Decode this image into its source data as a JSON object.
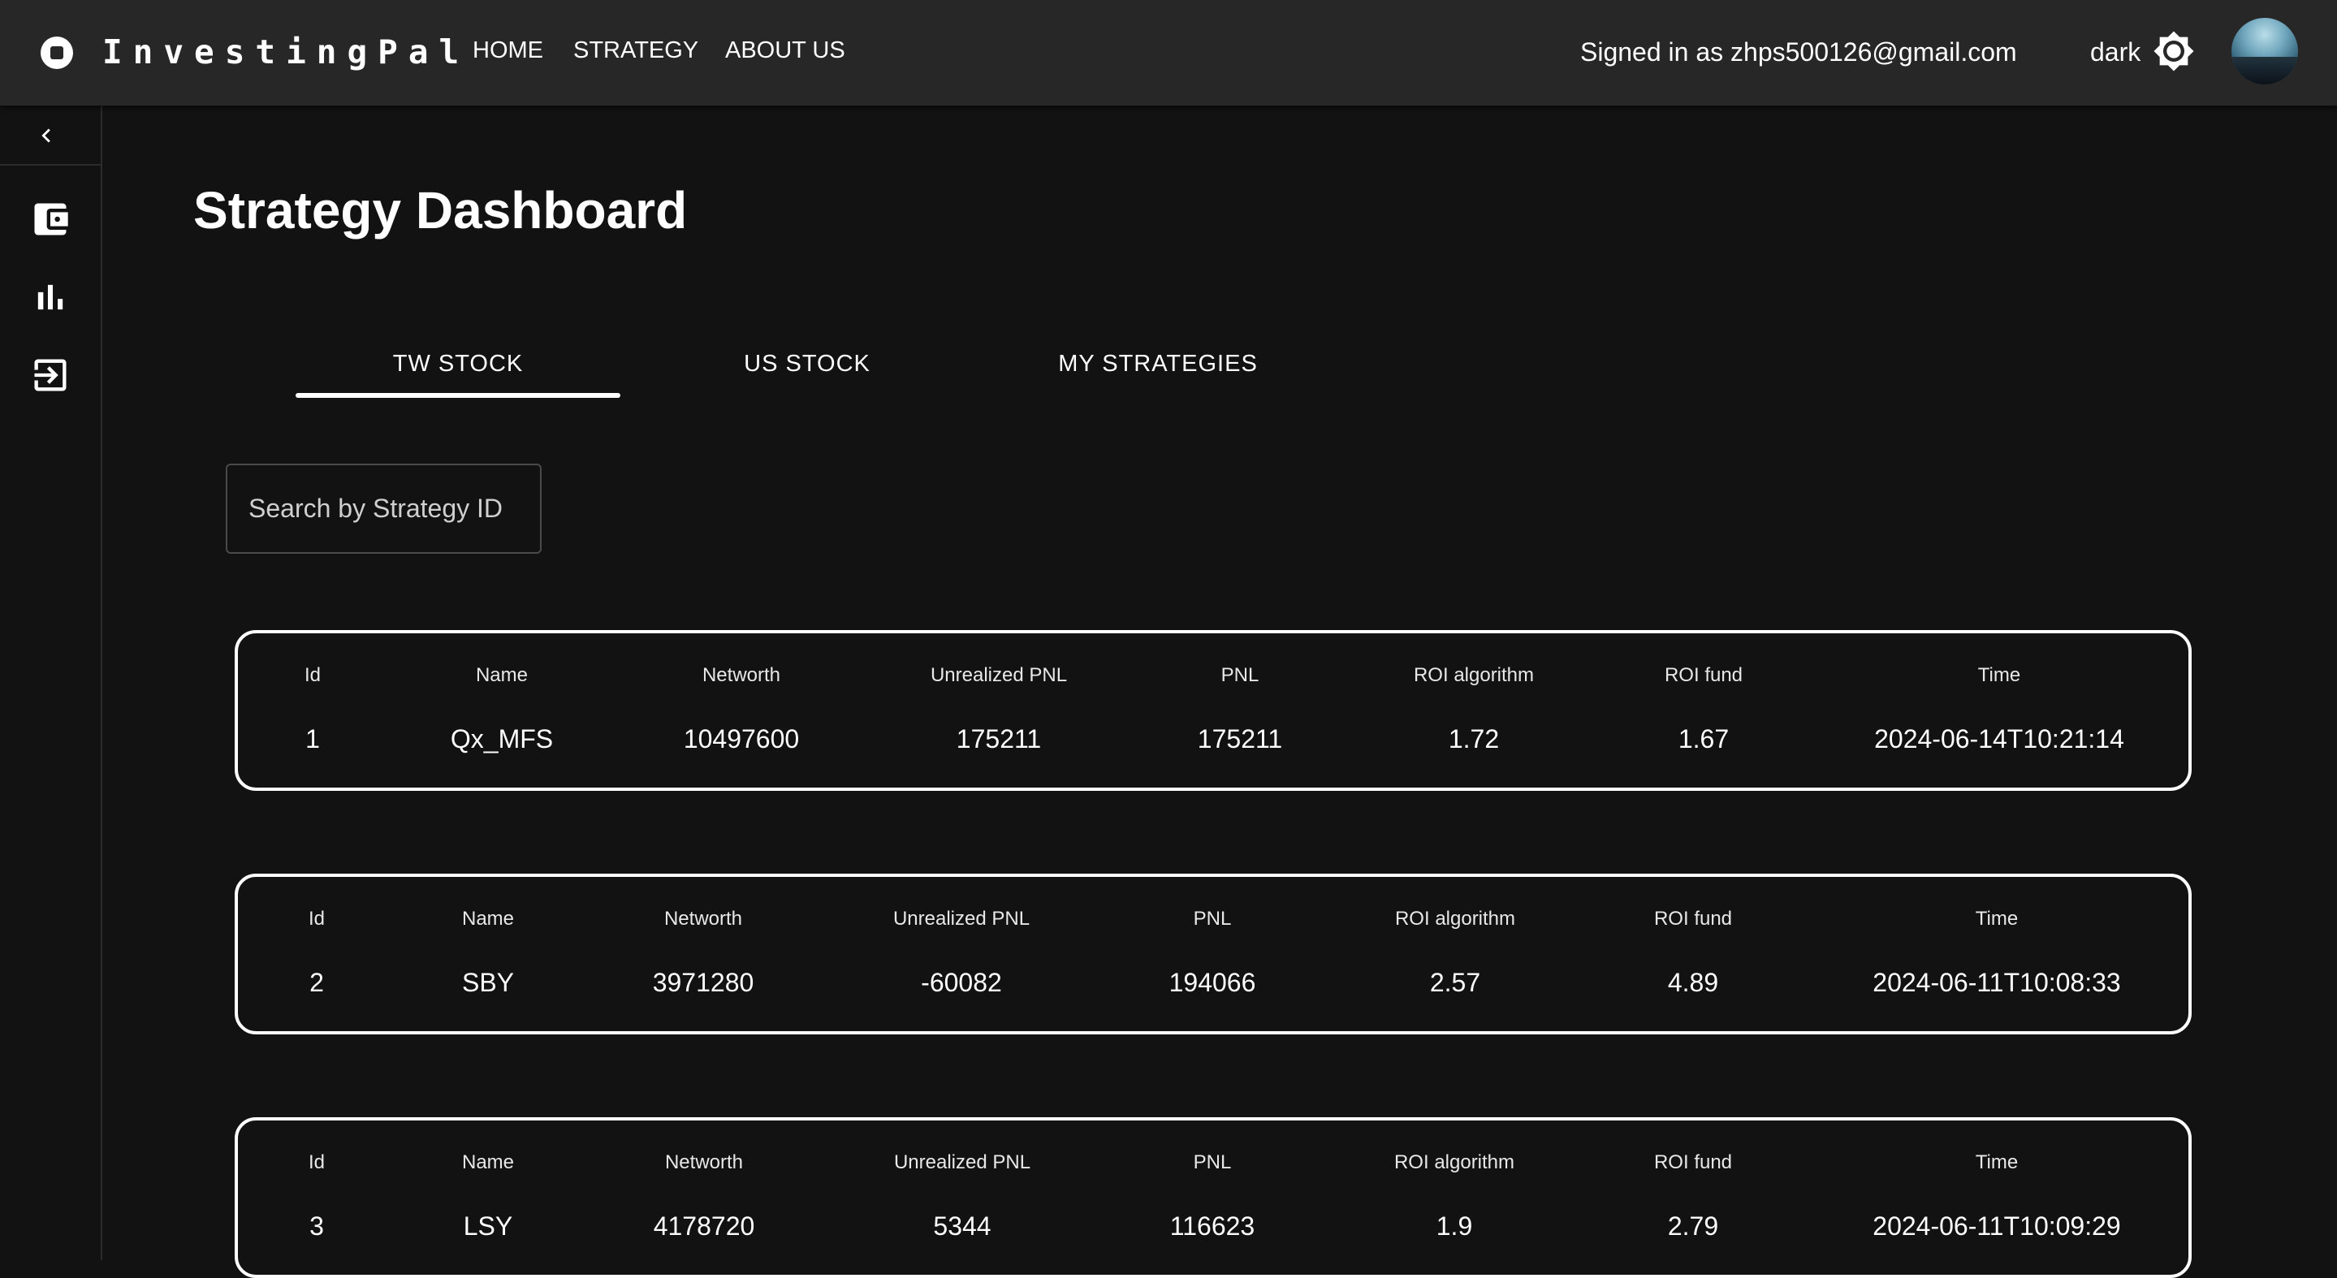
{
  "app": {
    "brand": "InvestingPal",
    "nav": [
      {
        "label": "HOME"
      },
      {
        "label": "STRATEGY"
      },
      {
        "label": "ABOUT US"
      }
    ],
    "signed_in": "Signed in as zhps500126@gmail.com",
    "theme_label": "dark",
    "icons": {
      "logo": "stop-circle-icon",
      "theme": "brightness-icon",
      "collapse": "chevron-left-icon",
      "wallet": "wallet-icon",
      "chart": "bar-chart-icon",
      "logout": "logout-icon"
    }
  },
  "page": {
    "title": "Strategy Dashboard",
    "tabs": [
      {
        "label": "TW STOCK",
        "active": true
      },
      {
        "label": "US STOCK",
        "active": false
      },
      {
        "label": "MY STRATEGIES",
        "active": false
      }
    ],
    "search_placeholder": "Search by Strategy ID"
  },
  "table": {
    "headers": [
      "Id",
      "Name",
      "Networth",
      "Unrealized PNL",
      "PNL",
      "ROI algorithm",
      "ROI fund",
      "Time"
    ],
    "rows": [
      {
        "values": [
          "1",
          "Qx_MFS",
          "10497600",
          "175211",
          "175211",
          "1.72",
          "1.67",
          "2024-06-14T10:21:14"
        ]
      },
      {
        "values": [
          "2",
          "SBY",
          "3971280",
          "-60082",
          "194066",
          "2.57",
          "4.89",
          "2024-06-11T10:08:33"
        ]
      },
      {
        "values": [
          "3",
          "LSY",
          "4178720",
          "5344",
          "116623",
          "1.9",
          "2.79",
          "2024-06-11T10:09:29"
        ]
      }
    ]
  },
  "colors": {
    "background": "#121212",
    "topbar": "#272727",
    "text": "#ffffff",
    "card_border": "#ffffff"
  }
}
